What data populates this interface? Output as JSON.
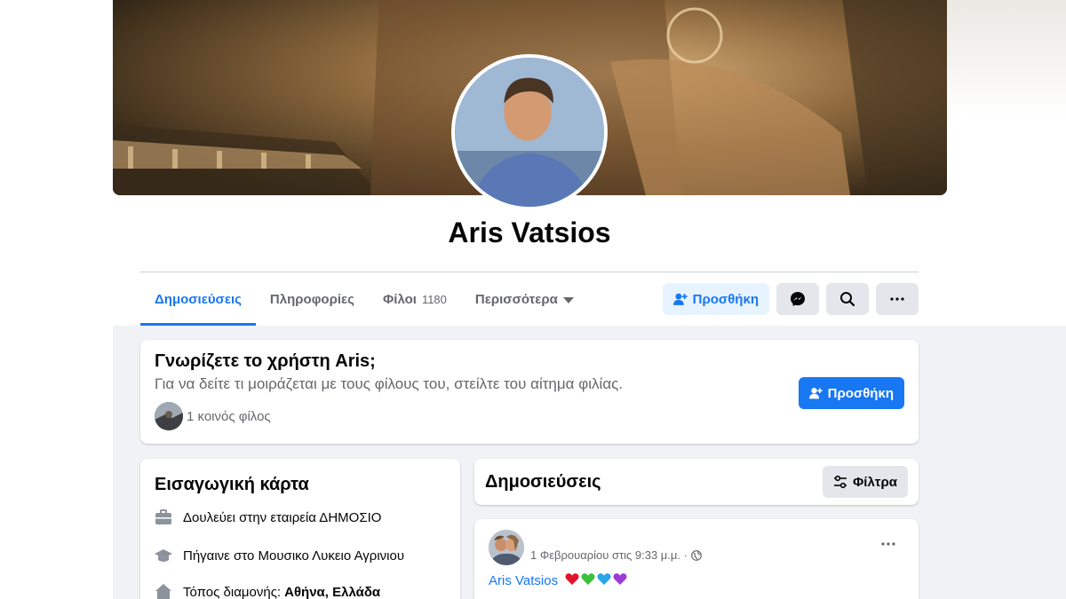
{
  "profile": {
    "name": "Aris Vatsios"
  },
  "tabs": [
    {
      "label": "Δημοσιεύσεις",
      "active": true
    },
    {
      "label": "Πληροφορίες"
    },
    {
      "label": "Φίλοι",
      "count": "1180"
    },
    {
      "label": "Περισσότερα"
    }
  ],
  "actions": {
    "add_friend": "Προσθήκη"
  },
  "know_card": {
    "title": "Γνωρίζετε το χρήστη Aris;",
    "subtitle": "Για να δείτε τι μοιράζεται με τους φίλους του, στείλτε του αίτημα φιλίας.",
    "mutual": "1 κοινός φίλος",
    "button": "Προσθήκη"
  },
  "intro": {
    "title": "Εισαγωγική κάρτα",
    "work": "Δουλεύει στην εταιρεία ΔΗΜΟΣΙΟ",
    "school": "Πήγαινε στο Μουσικο Λυκειο Αγρινιου",
    "location_prefix": "Τόπος διαμονής:",
    "location": "Αθήνα, Ελλάδα"
  },
  "posts": {
    "title": "Δημοσιεύσεις",
    "filter": "Φίλτρα"
  },
  "post": {
    "timestamp": "1 Φεβρουαρίου στις 9:33 μ.μ. ·",
    "author": "Aris Vatsios",
    "hearts": [
      "#e4132d",
      "#3cc13b",
      "#29a5e8",
      "#9d3ad6"
    ]
  },
  "colors": {
    "accent": "#1877f2",
    "accent_light": "#e7f3ff",
    "feed_bg": "#f0f2f5"
  }
}
